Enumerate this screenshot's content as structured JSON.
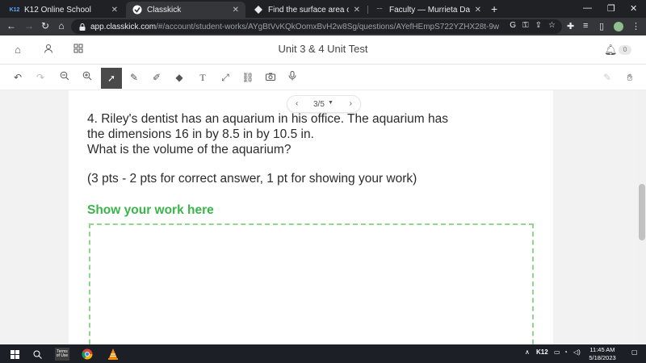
{
  "browser": {
    "tabs": [
      {
        "title": "K12 Online School",
        "favicon": "k12-icon",
        "active": false
      },
      {
        "title": "Classkick",
        "favicon": "classkick-icon",
        "active": true
      },
      {
        "title": "Find the surface area of the cub",
        "favicon": "brainly-icon",
        "active": false
      },
      {
        "title": "Faculty — Murrieta Dance Projec",
        "favicon": "dance-icon",
        "active": false
      }
    ],
    "url_host": "app.classkick.com",
    "url_path": "/#/account/student-works/AYgBtVvKQkOomxBvH2w8Sg/questions/AYefHEmpS722YZHX28t-9w"
  },
  "header": {
    "title": "Unit 3 & 4 Unit Test",
    "notification_count": "0"
  },
  "pager": {
    "label": "3/5"
  },
  "question": {
    "lines": [
      "4. Riley's dentist has an aquarium in his office.  The aquarium has",
      "the dimensions 16 in by 8.5 in by 10.5 in.",
      "What is the volume of the aquarium?"
    ],
    "points": "(3 pts - 2 pts for correct answer, 1 pt for showing your work)"
  },
  "work_area": {
    "label": "Show your work here"
  },
  "taskbar": {
    "time": "11:45 AM",
    "date": "5/18/2023",
    "tray_label": "K12",
    "pinned": [
      "Terms of Use"
    ]
  },
  "colors": {
    "accent_green": "#3ab54a",
    "dashed_border": "#8fd68f",
    "browser_dark": "#202124"
  }
}
